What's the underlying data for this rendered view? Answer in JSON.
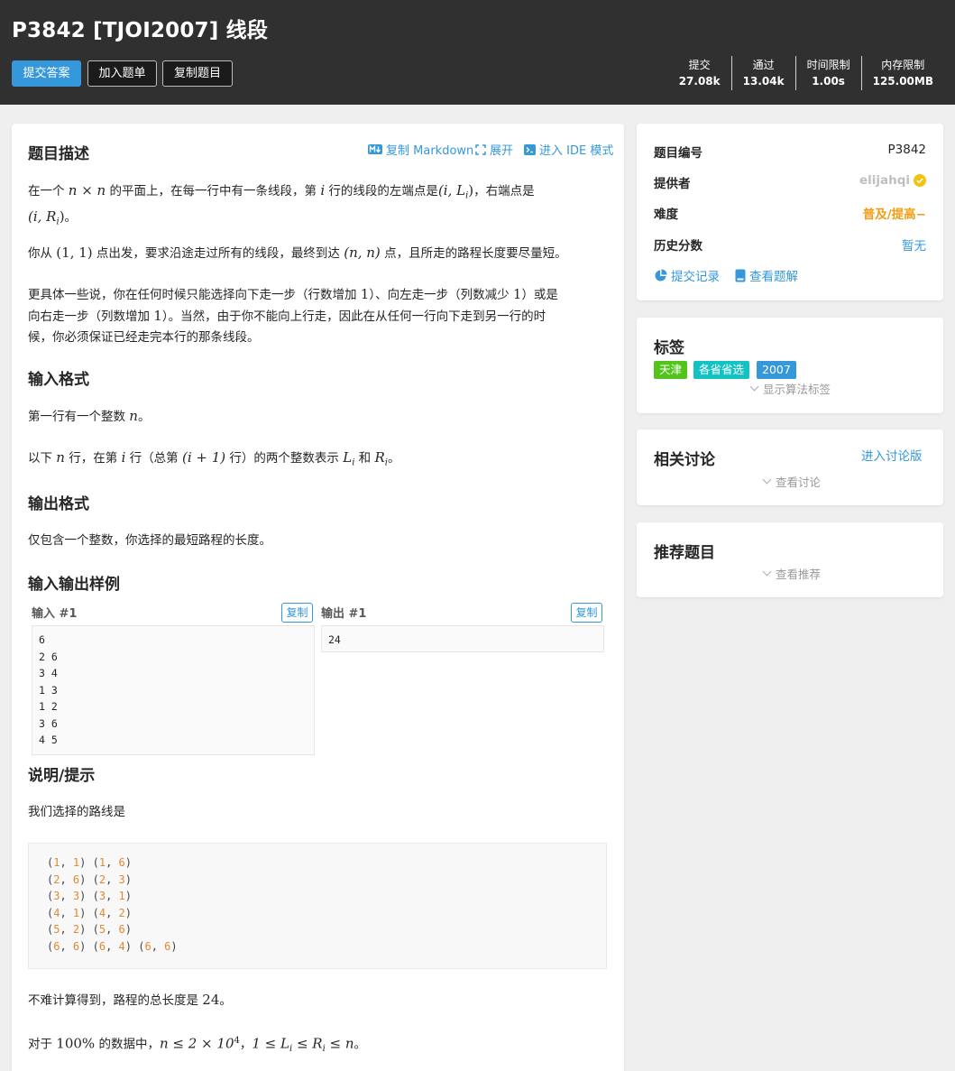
{
  "header": {
    "title": "P3842 [TJOI2007] 线段",
    "buttons": {
      "submit": "提交答案",
      "add_list": "加入题单",
      "copy_problem": "复制题目"
    },
    "stats": [
      {
        "key": "提交",
        "value": "27.08k"
      },
      {
        "key": "通过",
        "value": "13.04k"
      },
      {
        "key": "时间限制",
        "value": "1.00s"
      },
      {
        "key": "内存限制",
        "value": "125.00MB"
      }
    ]
  },
  "problem": {
    "section_desc": "题目描述",
    "links": {
      "copy_markdown": "复制 Markdown",
      "expand": "展开",
      "ide": "进入 IDE 模式"
    },
    "desc_p1_a": "在一个 ",
    "desc_p1_math1": "n × n",
    "desc_p1_b": " 的平面上，在每一行中有一条线段，第 ",
    "desc_p1_math2": "i",
    "desc_p1_c": " 行的线段的左端点是",
    "desc_p1_math3": "(i, L",
    "desc_p1_sub3": "i",
    "desc_p1_d": "，右端点是",
    "desc_p1_math4": "(i, R",
    "desc_p1_sub4": "i",
    "desc_p1_e": "。",
    "desc_p2_a": "你从 ",
    "desc_p2_math1": "(1, 1)",
    "desc_p2_b": " 点出发，要求沿途走过所有的线段，最终到达 ",
    "desc_p2_math2": "(n, n)",
    "desc_p2_c": " 点，且所走的路程长度要尽量短。",
    "desc_p3_l1a": "更具体一些说，你在任何时候只能选择向下走一步（行数增加 ",
    "desc_p3_l1m1": "1",
    "desc_p3_l1b": "）、向左走一步（列数减少 ",
    "desc_p3_l1m2": "1",
    "desc_p3_l1c": "）或是",
    "desc_p3_l2a": "向右走一步（列数增加 ",
    "desc_p3_l2m": "1",
    "desc_p3_l2b": "）。当然，由于你不能向上行走，因此在从任何一行向下走到另一行的时",
    "desc_p3_l3": "候，你必须保证已经走完本行的那条线段。",
    "section_input": "输入格式",
    "input_p1_a": "第一行有一个整数 ",
    "input_p1_m": "n",
    "input_p1_b": "。",
    "input_p2_a": "以下 ",
    "input_p2_m1": "n",
    "input_p2_b": " 行，在第 ",
    "input_p2_m2": "i",
    "input_p2_c": " 行（总第 ",
    "input_p2_m3": "(i + 1)",
    "input_p2_d": " 行）的两个整数表示 ",
    "input_p2_m4": "L",
    "input_p2_m4sub": "i",
    "input_p2_e": " 和 ",
    "input_p2_m5": "R",
    "input_p2_m5sub": "i",
    "input_p2_f": "。",
    "section_output": "输出格式",
    "output_p1": "仅包含一个整数，你选择的最短路程的长度。",
    "section_samples": "输入输出样例",
    "sample_in_label": "输入 #1",
    "sample_out_label": "输出 #1",
    "copy_label": "复制",
    "sample_in": "6\n2 6\n3 4\n1 3\n1 2\n3 6\n4 5",
    "sample_out": "24",
    "section_hint": "说明/提示",
    "hint_p1": "我们选择的路线是",
    "route": [
      [
        [
          "1",
          "1"
        ],
        [
          "1",
          "6"
        ]
      ],
      [
        [
          "2",
          "6"
        ],
        [
          "2",
          "3"
        ]
      ],
      [
        [
          "3",
          "3"
        ],
        [
          "3",
          "1"
        ]
      ],
      [
        [
          "4",
          "1"
        ],
        [
          "4",
          "2"
        ]
      ],
      [
        [
          "5",
          "2"
        ],
        [
          "5",
          "6"
        ]
      ],
      [
        [
          "6",
          "6"
        ],
        [
          "6",
          "4"
        ],
        [
          "6",
          "6"
        ]
      ]
    ],
    "hint_p2_a": "不难计算得到，路程的总长度是 ",
    "hint_p2_m": "24",
    "hint_p2_b": "。",
    "hint_p3_a": "对于 ",
    "hint_p3_m1": "100%",
    "hint_p3_b": " 的数据中，",
    "hint_p3_m2": "n ≤ 2 × 10",
    "hint_p3_m2sup": "4",
    "hint_p3_c": "，",
    "hint_p3_m3": "1 ≤ L",
    "hint_p3_m3sub": "i",
    "hint_p3_m3b": " ≤ R",
    "hint_p3_m3bsub": "i",
    "hint_p3_m3c": " ≤ n",
    "hint_p3_d": "。"
  },
  "info": {
    "rows": [
      {
        "key": "题目编号",
        "value": "P3842"
      },
      {
        "key": "提供者",
        "value": "elijahqi"
      },
      {
        "key": "难度",
        "value": "普及/提高−"
      },
      {
        "key": "历史分数",
        "value": "暂无"
      }
    ],
    "submit_record": "提交记录",
    "view_solution": "查看题解"
  },
  "tags": {
    "title": "标签",
    "items": [
      {
        "label": "天津",
        "color": "#52c41a"
      },
      {
        "label": "各省省选",
        "color": "#13c2c2"
      },
      {
        "label": "2007",
        "color": "#3498db"
      }
    ],
    "show_algo": "显示算法标签"
  },
  "discuss": {
    "title": "相关讨论",
    "enter": "进入讨论版",
    "view": "查看讨论"
  },
  "recommend": {
    "title": "推荐题目",
    "view": "查看推荐"
  },
  "colors": {
    "accent": "#3498db",
    "header_bg": "#303030",
    "difficulty": "#f39c11",
    "verified": "#f1c40f"
  }
}
